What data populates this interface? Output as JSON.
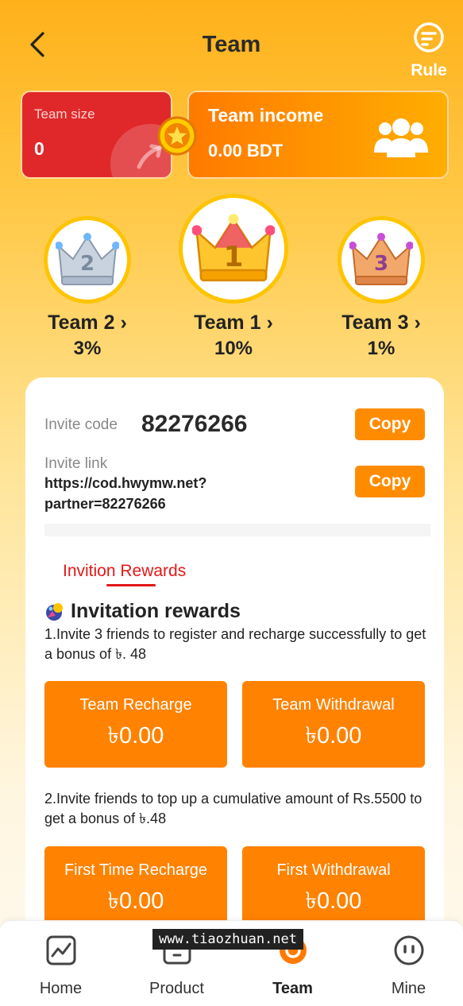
{
  "header": {
    "title": "Team",
    "rule_label": "Rule"
  },
  "team_size": {
    "label": "Team size",
    "value": "0"
  },
  "team_income": {
    "label": "Team income",
    "value": "0.00 BDT"
  },
  "teams": [
    {
      "name": "Team 2 ›",
      "pct": "3%"
    },
    {
      "name": "Team 1 ›",
      "pct": "10%"
    },
    {
      "name": "Team 3 ›",
      "pct": "1%"
    }
  ],
  "invite": {
    "code_label": "Invite code",
    "code_value": "82276266",
    "link_label": "Invite link",
    "link_line1": "https://cod.hwymw.net?",
    "link_line2": "partner=82276266",
    "copy_label": "Copy"
  },
  "rewards": {
    "tab_label": "Invition Rewards",
    "title": "Invitation rewards",
    "desc1": "1.Invite 3 friends to register and recharge successfully to get a bonus of ৳. 48",
    "desc2": "2.Invite friends to top up a cumulative amount of Rs.5500 to get a bonus of ৳.48",
    "stats": [
      {
        "label": "Team Recharge",
        "value": "৳0.00"
      },
      {
        "label": "Team Withdrawal",
        "value": "৳0.00"
      },
      {
        "label": "First Time Recharge",
        "value": "৳0.00"
      },
      {
        "label": "First Withdrawal",
        "value": "৳0.00"
      }
    ]
  },
  "tabbar": {
    "items": [
      {
        "label": "Home",
        "icon": "chart-icon"
      },
      {
        "label": "Product",
        "icon": "box-icon"
      },
      {
        "label": "Team",
        "icon": "team-icon"
      },
      {
        "label": "Mine",
        "icon": "face-icon"
      }
    ]
  },
  "watermark": "www.tiaozhuan.net",
  "colors": {
    "accent": "#ff8200",
    "red_card": "#e0282a",
    "gold": "#ffc400",
    "tab_red": "#e21717"
  }
}
